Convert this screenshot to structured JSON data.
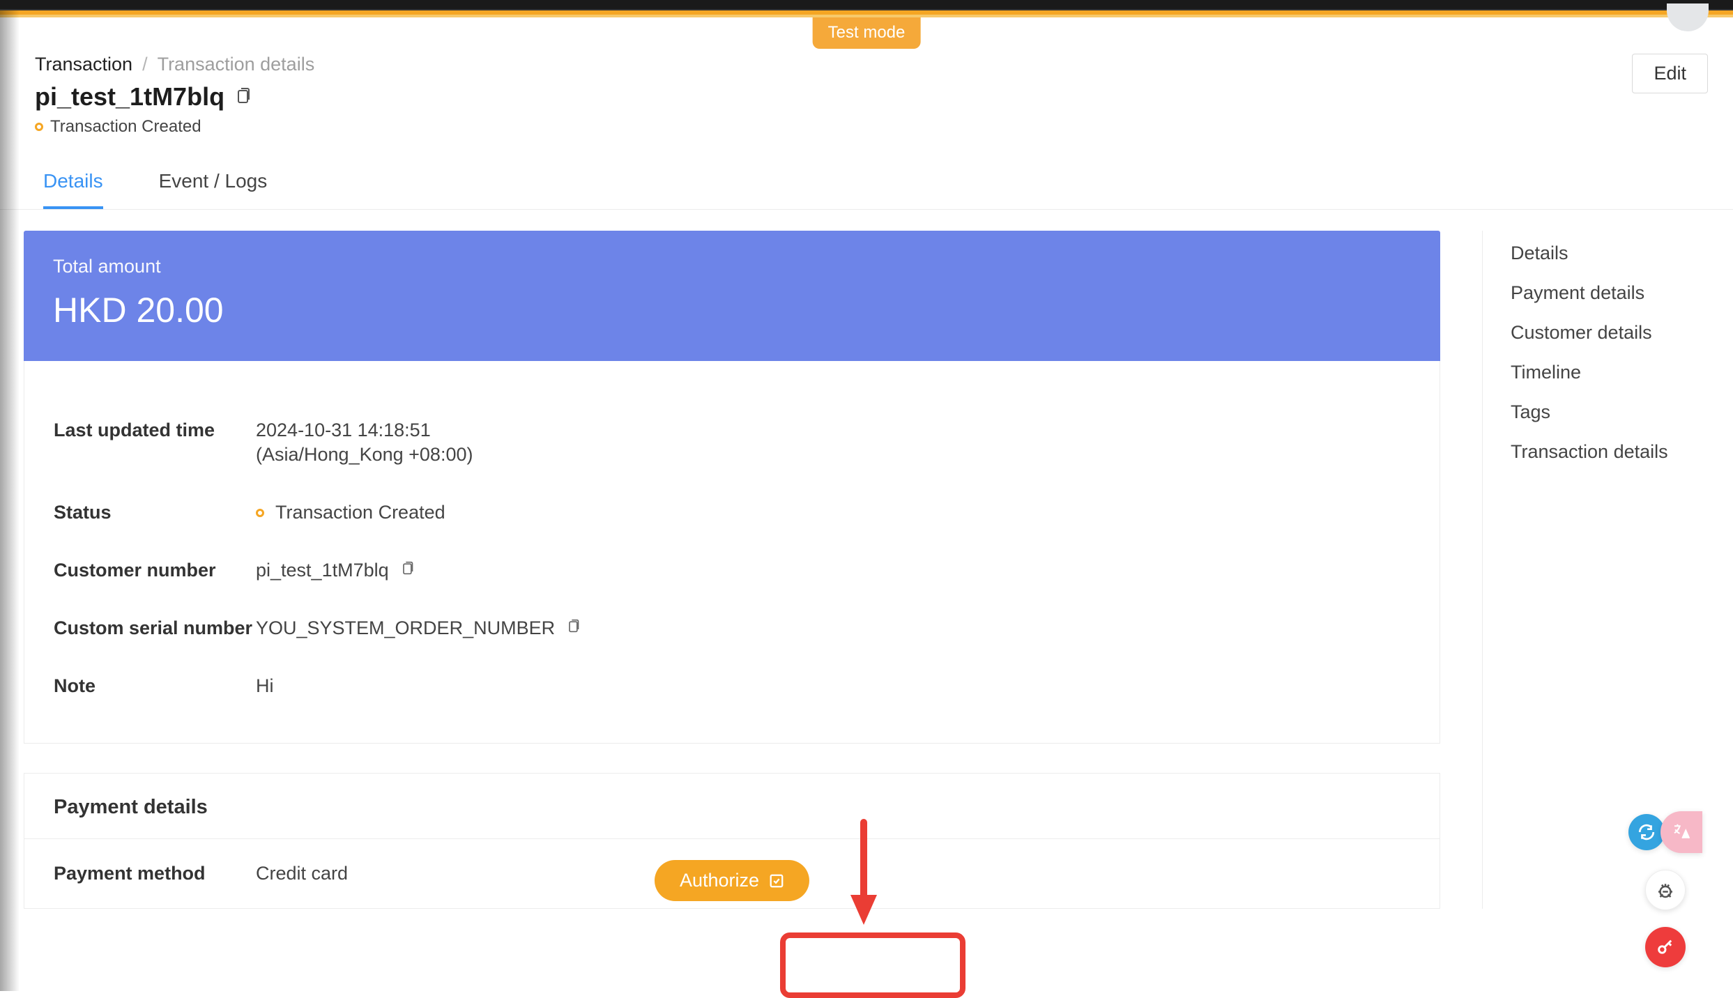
{
  "header": {
    "test_mode": "Test mode",
    "breadcrumb": {
      "root": "Transaction",
      "current": "Transaction details"
    },
    "title": "pi_test_1tM7blq",
    "status": "Transaction Created",
    "edit": "Edit"
  },
  "tabs": {
    "details": "Details",
    "logs": "Event / Logs"
  },
  "summary": {
    "total_label": "Total amount",
    "total_value": "HKD 20.00"
  },
  "details": {
    "last_updated_time_label": "Last updated time",
    "last_updated_time_value": "2024-10-31 14:18:51",
    "last_updated_time_tz": "(Asia/Hong_Kong +08:00)",
    "status_label": "Status",
    "status_value": "Transaction Created",
    "customer_number_label": "Customer number",
    "customer_number_value": "pi_test_1tM7blq",
    "custom_serial_label": "Custom serial number",
    "custom_serial_value": "YOU_SYSTEM_ORDER_NUMBER",
    "note_label": "Note",
    "note_value": "Hi"
  },
  "payment_details": {
    "title": "Payment details",
    "payment_method_label": "Payment method",
    "payment_method_value": "Credit card",
    "authorize_button": "Authorize"
  },
  "sidenav": {
    "items": [
      "Details",
      "Payment details",
      "Customer details",
      "Timeline",
      "Tags",
      "Transaction details"
    ]
  },
  "colors": {
    "accent_orange": "#f5a623",
    "accent_blue": "#6d84e8",
    "link_blue": "#3993f4",
    "annotation_red": "#ea3d34"
  }
}
